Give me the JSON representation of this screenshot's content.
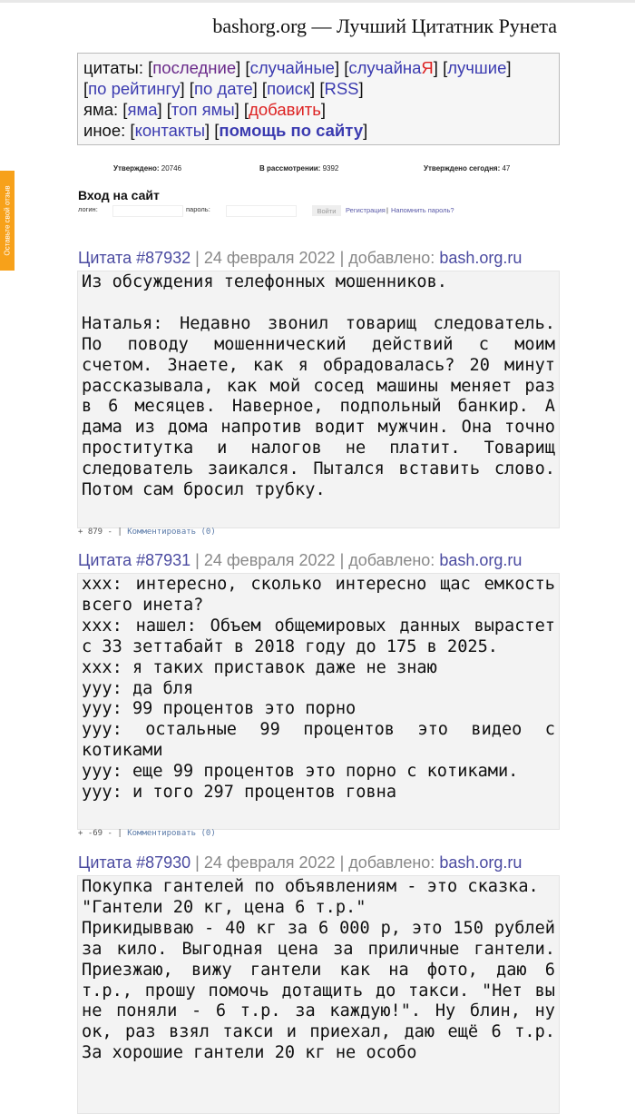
{
  "site_title": "bashorg.org — Лучший Цитатник Рунета",
  "menu": {
    "quotes_label": "цитаты:",
    "quotes": [
      "последние",
      "случайные",
      "случайна",
      "лучшие",
      "по рейтингу",
      "по дате",
      "поиск",
      "RSS"
    ],
    "random_red_char": "Я",
    "pit_label": "яма:",
    "pit": [
      "яма",
      "топ ямы",
      "добавить"
    ],
    "other_label": "иное:",
    "other": [
      "контакты",
      "помощь по сайту"
    ]
  },
  "stats": {
    "approved_label": "Утверждено:",
    "approved": "20746",
    "review_label": "В рассмотрении:",
    "review": "9392",
    "today_label": "Утверждено сегодня:",
    "today": "47"
  },
  "login": {
    "title": "Вход на сайт",
    "login_label": "логин:",
    "login_value": "",
    "password_label": "пароль:",
    "password_value": "",
    "submit": "Войти",
    "register": "Регистрация",
    "separator": "|",
    "remind": "Напомнить пароль?"
  },
  "feedback_tab": "Оставьте свой отзыв",
  "quotes": [
    {
      "id": "Цитата #87932",
      "date": "| 24 февраля 2022 | добавлено:",
      "source": "bash.org.ru",
      "text": "Из обсуждения телефонных мошенников.\n\nНаталья: Недавно звонил товарищ следователь. По поводу мошеннический действий с моим счетом. Знаете, как я обрадовалась? 20 минут рассказывала, как мой сосед машины меняет раз в 6 месяцев. Наверное, подпольный банкир. А дама из дома напротив водит мужчин. Она точно проститутка и налогов не платит. Товарищ следователь заикался. Пытался вставить слово. Потом сам бросил трубку.",
      "plus": "+",
      "rating": "879",
      "minus": "-",
      "sep": "|",
      "comment": "Комментировать (0)"
    },
    {
      "id": "Цитата #87931",
      "date": "| 24 февраля 2022 | добавлено:",
      "source": "bash.org.ru",
      "text": "xxx: интересно, сколько интересно щас емкость всего инета?\nxxx: нашел: Объем общемировых данных вырастет с 33 зеттабайт в 2018 году до 175 в 2025.\nxxx: я таких приставок даже не знаю\nууу: да бля\nууу: 99 процентов это порно\nууу: остальные 99 процентов это видео с котиками\nууу: еще 99 процентов это порно с котиками.\nууу: и того 297 процентов говна",
      "plus": "+",
      "rating": "-69",
      "minus": "-",
      "sep": "|",
      "comment": "Комментировать (0)"
    },
    {
      "id": "Цитата #87930",
      "date": "| 24 февраля 2022 | добавлено:",
      "source": "bash.org.ru",
      "text": "Покупка гантелей по объявлениям - это сказка.\n\"Гантели 20 кг, цена 6 т.р.\"\nПрикидывваю - 40 кг за 6 000 р, это 150 рублей за кило. Выгодная цена за приличные гантели. Приезжаю, вижу гантели как на фото, даю 6 т.р., прошу помочь дотащить до такси. \"Нет вы не поняли - 6 т.р. за каждую!\". Ну блин, ну ок, раз взял такси и приехал, даю ещё 6 т.р. За хорошие гантели 20 кг не особо"
    }
  ],
  "colors": {
    "link": "#3b3bb0",
    "visited": "#6a2a8a",
    "red": "#dd2222",
    "feedback": "#f7a11a",
    "quote_bg": "#f3f3f3"
  }
}
